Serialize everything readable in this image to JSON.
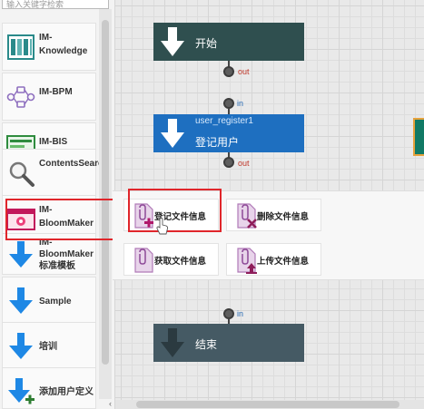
{
  "palette": {
    "search_placeholder": "输入关键字检索",
    "items": [
      {
        "label": "IM-Knowledge",
        "icon": "knowledge-icon"
      },
      {
        "label": "IM-BPM",
        "icon": "bpm-flow-icon"
      },
      {
        "label": "IM-BIS",
        "icon": "bis-icon"
      },
      {
        "label": "ContentsSearch",
        "icon": "magnifier-icon"
      },
      {
        "label": "IM-BloomMaker",
        "icon": "bloommaker-icon"
      },
      {
        "label": "IM-BloomMaker 标准模板",
        "icon": "arrow-down-icon"
      },
      {
        "label": "Sample",
        "icon": "arrow-down-icon"
      },
      {
        "label": "培训",
        "icon": "arrow-down-icon"
      },
      {
        "label": "添加用户定义",
        "icon": "arrow-down-plus-icon"
      }
    ]
  },
  "canvas": {
    "start_node": {
      "label": "开始",
      "out_label": "out"
    },
    "register_node": {
      "id_label": "user_register1",
      "label": "登记用户",
      "in_label": "in",
      "out_label": "out"
    },
    "end_node": {
      "label": "结束",
      "in_label": "in"
    }
  },
  "popup": {
    "items": [
      {
        "label": "登记文件信息",
        "icon": "file-add-icon"
      },
      {
        "label": "删除文件信息",
        "icon": "file-delete-icon"
      },
      {
        "label": "获取文件信息",
        "icon": "file-get-icon"
      },
      {
        "label": "上传文件信息",
        "icon": "file-upload-icon"
      }
    ]
  },
  "colors": {
    "start_node": "#2f4f4f",
    "register_node": "#1e6fc0",
    "end_node": "#455a64",
    "highlight": "#e0262b",
    "arrow_blue": "#1e88e5"
  }
}
